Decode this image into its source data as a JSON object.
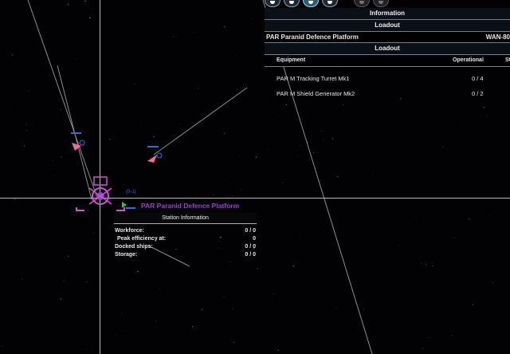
{
  "panel": {
    "tab_information": "Information",
    "tab_loadout": "Loadout",
    "object_name": "PAR Paranid Defence Platform",
    "object_id": "WAN-80",
    "section_loadout": "Loadout",
    "columns": {
      "equipment": "Equipment",
      "operational": "Operational",
      "status_partial": "St"
    },
    "equipment": [
      {
        "name": "PAR M Tracking Turret Mk1",
        "operational": "0 / 4"
      },
      {
        "name": "PAR M Shield Generator Mk2",
        "operational": "0 / 2"
      }
    ]
  },
  "map": {
    "station_label": "PAR Paranid Defence Platform",
    "station_marker_label": "(0-1)",
    "station_info": {
      "title": "Station Information",
      "rows": [
        {
          "label": "Workforce:",
          "value": "0 / 0"
        },
        {
          "label": "Peak efficiency at:",
          "value": "0"
        },
        {
          "label": "Docked ships:",
          "value": "0 / 0"
        },
        {
          "label": "Storage:",
          "value": "0 / 0"
        }
      ]
    }
  },
  "toolbar": {
    "icons": [
      "info-icon",
      "object-list-icon",
      "property-icon",
      "mission-icon",
      "disabled-icon-1",
      "disabled-icon-2"
    ]
  },
  "colors": {
    "station_purple": "#9a3fd6",
    "station_magenta": "#d24fd6",
    "marker_blue": "#2a6fe0",
    "marker_pink": "#f06aa0"
  }
}
